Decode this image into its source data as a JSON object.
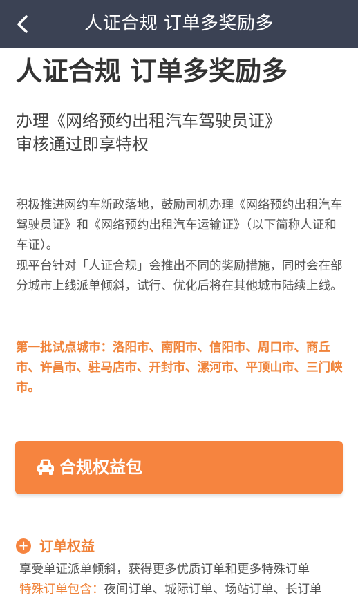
{
  "topbar": {
    "title": "人证合规 订单多奖励多"
  },
  "icons": {
    "back": "chevron-left-icon",
    "car": "car-icon",
    "plus": "plus-circle-icon"
  },
  "colors": {
    "topbar_bg": "#3b4254",
    "accent_orange": "#f6843f"
  },
  "main": {
    "headline": "人证合规 订单多奖励多",
    "subhead_lines": [
      "办理《网络预约出租汽车驾驶员证》",
      "审核通过即享特权"
    ],
    "para1": "积极推进网约车新政落地，鼓励司机办理《网络预约出租汽车驾驶员证》和《网络预约出租汽车运输证》（以下简称人证和车证）。",
    "para2": "现平台针对「人证合规」会推出不同的奖励措施，同时会在部分城市上线派单倾斜，试行、优化后将在其他城市陆续上线。",
    "pilot_cities": "第一批试点城市：洛阳市、南阳市、信阳市、周口市、商丘市、许昌市、驻马店市、开封市、漯河市、平顶山市、三门峡市。"
  },
  "benefit_button": {
    "label": "合规权益包"
  },
  "order_benefits": {
    "title": "订单权益",
    "description": "享受单证派单倾斜，获得更多优质订单和更多特殊订单",
    "special_label": "特殊订单包含：",
    "special_items": "夜间订单、城际订单、场站订单、长订单"
  }
}
